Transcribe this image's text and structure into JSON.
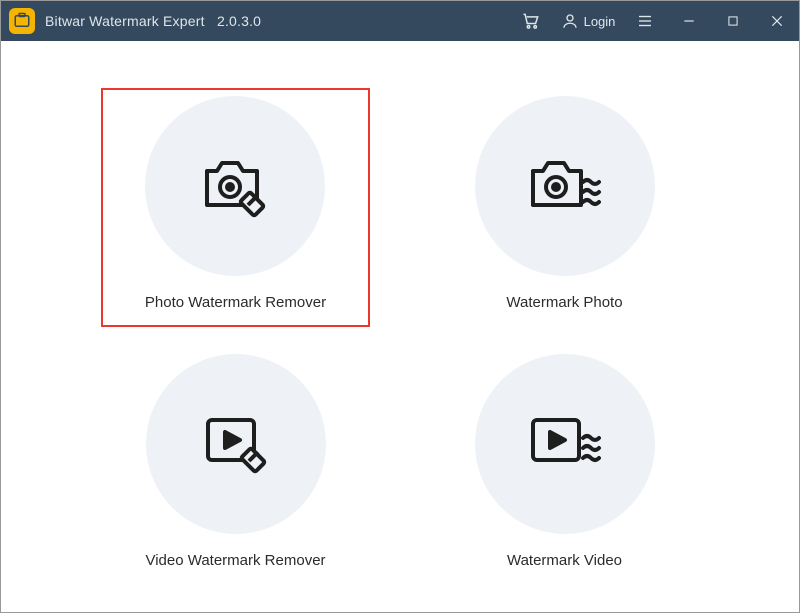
{
  "titlebar": {
    "app_name": "Bitwar Watermark Expert",
    "version": "2.0.3.0",
    "login_label": "Login"
  },
  "cards": {
    "photo_remove": "Photo Watermark Remover",
    "photo_add": "Watermark Photo",
    "video_remove": "Video Watermark Remover",
    "video_add": "Watermark Video"
  }
}
